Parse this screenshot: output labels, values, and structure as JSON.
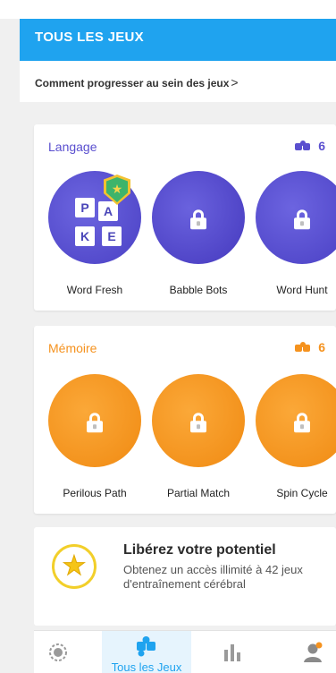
{
  "header": {
    "title": "TOUS LES JEUX"
  },
  "progress_link": {
    "label": "Comment progresser au sein des jeux",
    "chevron": ">"
  },
  "categories": [
    {
      "name": "Langage",
      "count": "6",
      "color": "#5a4fcf",
      "count_icon": "puzzle-icon",
      "games": [
        {
          "name": "Word Fresh",
          "locked": false,
          "tiles": [
            "P",
            "A",
            "K",
            "E"
          ],
          "badge": "shield-star-icon"
        },
        {
          "name": "Babble Bots",
          "locked": true
        },
        {
          "name": "Word Hunt",
          "locked": true
        }
      ]
    },
    {
      "name": "Mémoire",
      "count": "6",
      "color": "#f5921e",
      "count_icon": "puzzle-icon",
      "games": [
        {
          "name": "Perilous Path",
          "locked": true
        },
        {
          "name": "Partial Match",
          "locked": true
        },
        {
          "name": "Spin Cycle",
          "locked": true
        }
      ]
    }
  ],
  "promo": {
    "title": "Libérez votre potentiel",
    "description": "Obtenez un accès illimité à 42 jeux d'entraînement cérébral",
    "icon": "star-badge-icon"
  },
  "tabs": [
    {
      "label": "",
      "icon": "training-icon",
      "active": false
    },
    {
      "label": "Tous les Jeux",
      "icon": "puzzle-icon",
      "active": true
    },
    {
      "label": "",
      "icon": "stats-icon",
      "active": false
    },
    {
      "label": "",
      "icon": "profile-icon",
      "active": false
    }
  ],
  "colors": {
    "header": "#1fa3ef",
    "language": "#5a4fcf",
    "memory": "#f5921e"
  }
}
